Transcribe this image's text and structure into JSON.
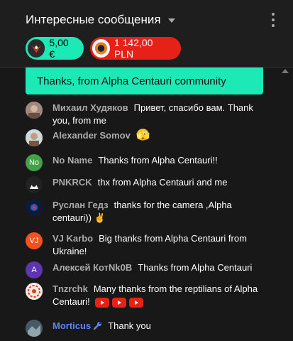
{
  "header": {
    "title": "Интересные сообщения"
  },
  "chips": [
    {
      "amount": "5,00 €"
    },
    {
      "amount": "1 142,00 PLN"
    }
  ],
  "pinned": {
    "text": "Thanks, from Alpha Centauri community"
  },
  "messages": [
    {
      "author": "Михаил Худяков",
      "text": "Привет, спасибо вам. Thank you, from me"
    },
    {
      "author": "Alexander Somov",
      "text": "🫣"
    },
    {
      "author": "No Name",
      "initials": "No",
      "text": "Thanks from Alpha Centauri!!"
    },
    {
      "author": "PNKRCK",
      "text": "thx from Alpha Centauri and me"
    },
    {
      "author": "Руслан Гедз",
      "text": "thanks for the camera ,Alpha centauri)) ✌️"
    },
    {
      "author": "VJ Karbo",
      "initials": "VJ",
      "text": "Big thanks from Alpha Centauri from Ukraine!"
    },
    {
      "author": "Алексей КотNk0B",
      "initials": "A",
      "text": "Thanks from Alpha Centauri"
    },
    {
      "author": "Tnzrchk",
      "text": "Many thanks from the reptilians of Alpha Centauri!"
    },
    {
      "author": "Morticus",
      "text": "Thank you"
    }
  ],
  "colors": {
    "accent_green": "#1de9b6",
    "superchat_red": "#e62117",
    "moderator_blue": "#5e84f1"
  }
}
